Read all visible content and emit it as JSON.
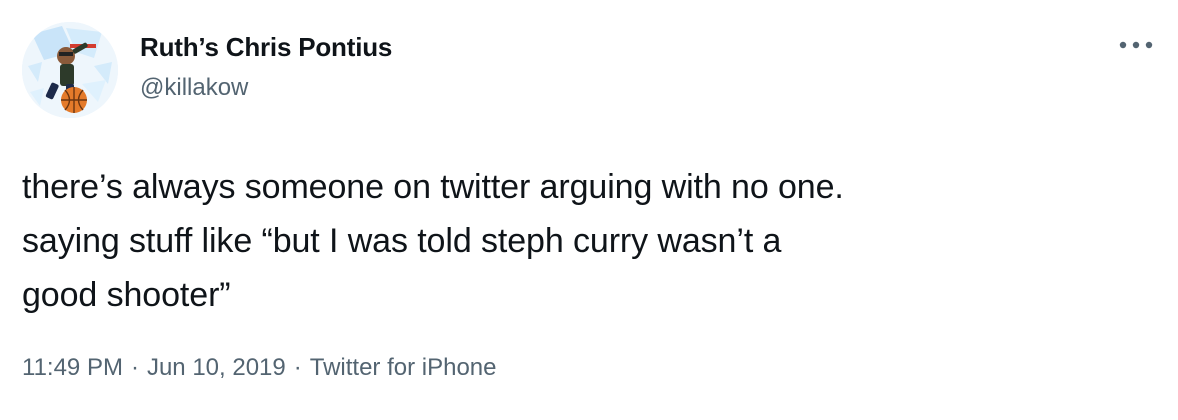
{
  "author": {
    "display_name": "Ruth’s Chris Pontius",
    "handle": "@killakow",
    "avatar_icon": "avatar-bitmoji-basketball-icon"
  },
  "more_icon": "more-dots-icon",
  "tweet": {
    "text": "there’s always someone on twitter arguing with no one.\nsaying stuff like “but I was told steph curry wasn’t a\ngood shooter”"
  },
  "meta": {
    "time": "11:49 PM",
    "separator": "·",
    "date": "Jun 10, 2019",
    "source": "Twitter for iPhone"
  },
  "colors": {
    "text": "#0f1419",
    "secondary": "#536471"
  }
}
